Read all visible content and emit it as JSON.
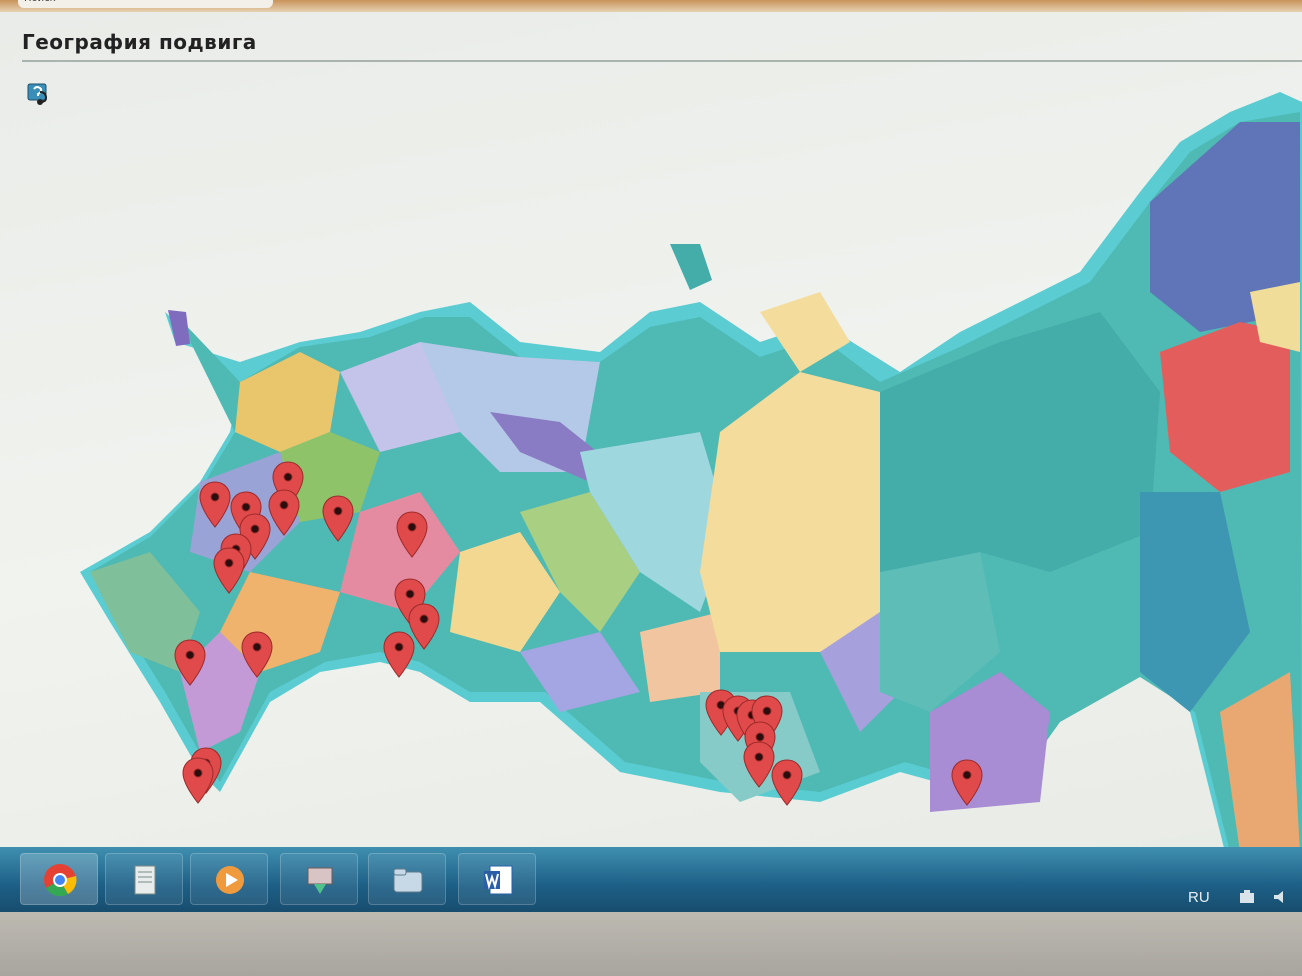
{
  "browser": {
    "search_tab_label": "Поиск"
  },
  "page": {
    "title": "География подвига"
  },
  "help_icon": "help-question-icon",
  "map": {
    "sea_color": "#37c4c9",
    "land_base_color": "#48b8b0",
    "marker_color": "#e04a4a"
  },
  "taskbar": {
    "apps": [
      {
        "name": "chrome",
        "icon": "chrome-icon"
      },
      {
        "name": "documents",
        "icon": "document-icon"
      },
      {
        "name": "media-player",
        "icon": "media-player-icon"
      },
      {
        "name": "downloads",
        "icon": "download-icon"
      },
      {
        "name": "explorer",
        "icon": "folder-icon"
      },
      {
        "name": "word",
        "icon": "word-icon"
      }
    ],
    "language": "RU"
  }
}
